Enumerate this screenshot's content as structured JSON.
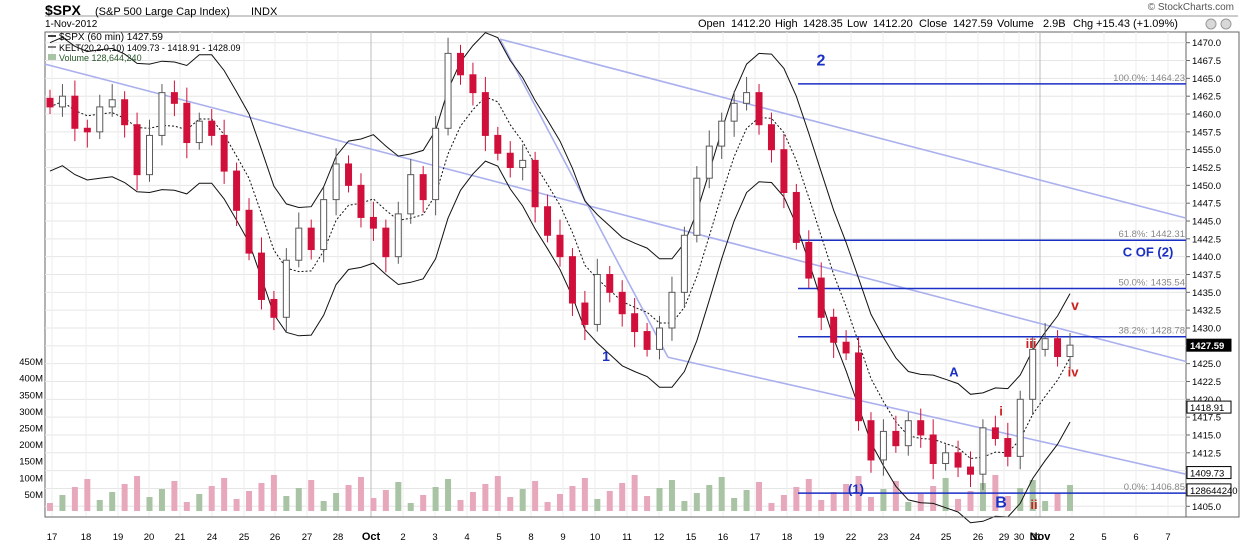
{
  "header": {
    "symbol": "$SPX",
    "name": "(S&P 500 Large Cap Index)",
    "exchange": "INDX",
    "date": "1-Nov-2012",
    "open_label": "Open",
    "open": "1412.20",
    "high_label": "High",
    "high": "1428.35",
    "low_label": "Low",
    "low": "1412.20",
    "close_label": "Close",
    "close": "1427.59",
    "volume_label": "Volume",
    "volume": "2.9B",
    "chg_label": "Chg",
    "chg": "+15.43 (+1.09%)",
    "watermark": "© StockCharts.com"
  },
  "legend": {
    "line1": "$SPX (60 min) 1427.59",
    "line2": "KELT(20,2.0,10) 1409.73 - 1418.91 - 1428.09",
    "line3": "Volume 128,644,240"
  },
  "annotations": [
    {
      "text": "2",
      "color": "#1a2fc4"
    },
    {
      "text": "1",
      "color": "#1a2fc4"
    },
    {
      "text": "(1)",
      "color": "#1a2fc4"
    },
    {
      "text": "A",
      "color": "#1a2fc4"
    },
    {
      "text": "B",
      "color": "#1a2fc4"
    },
    {
      "text": "C OF (2)",
      "color": "#1a2fc4"
    },
    {
      "text": "i",
      "color": "#cc1f1f"
    },
    {
      "text": "ii",
      "color": "#cc1f1f"
    },
    {
      "text": "iii",
      "color": "#cc1f1f"
    },
    {
      "text": "iv",
      "color": "#cc1f1f"
    },
    {
      "text": "v",
      "color": "#cc1f1f"
    }
  ],
  "fib_labels": [
    "100.0%: 1464.23",
    "61.8%: 1442.31",
    "50.0%: 1435.54",
    "38.2%: 1428.78",
    "0.0%: 1406.85"
  ],
  "price_tags": [
    "1427.59",
    "1418.91",
    "1409.73",
    "128644240"
  ],
  "colors": {
    "up": "#5a5a5a",
    "down": "#d0103a",
    "fib": "#1a2fc4",
    "channel": "#aab0ee",
    "vol_up": "#a9c4a4",
    "vol_down": "#e8a8bc"
  },
  "chart_data": {
    "type": "candlestick",
    "title": "$SPX (S&P 500 Large Cap Index) 60 min",
    "y_ticks": [
      "1470.0",
      "1467.5",
      "1465.0",
      "1462.5",
      "1460.0",
      "1457.5",
      "1455.0",
      "1452.5",
      "1450.0",
      "1447.5",
      "1445.0",
      "1442.5",
      "1440.0",
      "1437.5",
      "1435.0",
      "1432.5",
      "1430.0",
      "1427.5",
      "1425.0",
      "1422.5",
      "1420.0",
      "1417.5",
      "1415.0",
      "1412.5",
      "1410.0",
      "1407.5",
      "1405.0"
    ],
    "ylim": [
      1403.5,
      1471.5
    ],
    "vol_ticks": [
      "450M",
      "400M",
      "350M",
      "300M",
      "250M",
      "200M",
      "150M",
      "100M",
      "50M"
    ],
    "x_ticks": [
      "17",
      "18",
      "19",
      "20",
      "21",
      "24",
      "25",
      "26",
      "27",
      "28",
      "Oct",
      "2",
      "3",
      "4",
      "5",
      "8",
      "9",
      "10",
      "11",
      "12",
      "15",
      "16",
      "17",
      "18",
      "19",
      "22",
      "23",
      "24",
      "25",
      "26",
      "29",
      "30",
      "31",
      "Nov",
      "2",
      "5",
      "6",
      "7"
    ],
    "close_series": [
      1461.0,
      1462.5,
      1458.0,
      1457.5,
      1461.0,
      1462.0,
      1458.5,
      1451.5,
      1457.0,
      1463.0,
      1461.5,
      1456.0,
      1459.0,
      1457.0,
      1452.0,
      1446.5,
      1440.5,
      1434.0,
      1431.5,
      1439.5,
      1444.0,
      1441.0,
      1448.0,
      1453.0,
      1450.0,
      1445.5,
      1444.0,
      1440.0,
      1446.0,
      1451.5,
      1448.0,
      1458.0,
      1468.5,
      1465.5,
      1463.0,
      1457.0,
      1454.5,
      1452.5,
      1453.5,
      1447.0,
      1443.0,
      1440.0,
      1433.5,
      1430.5,
      1437.5,
      1435.0,
      1432.0,
      1429.5,
      1427.0,
      1430.0,
      1435.0,
      1443.0,
      1451.0,
      1455.5,
      1459.0,
      1461.5,
      1463.0,
      1458.5,
      1455.0,
      1449.0,
      1442.0,
      1437.0,
      1431.5,
      1428.0,
      1426.5,
      1417.0,
      1411.5,
      1415.5,
      1413.5,
      1417.0,
      1415.0,
      1411.0,
      1412.5,
      1410.5,
      1409.5,
      1416.0,
      1414.5,
      1412.0,
      1420.0,
      1427.0,
      1428.5,
      1426.0,
      1427.59
    ],
    "kelt_upper_end": 1428.09,
    "kelt_mid_end": 1418.91,
    "kelt_lower_end": 1409.73,
    "fib_levels": [
      1464.23,
      1442.31,
      1435.54,
      1428.78,
      1406.85
    ]
  }
}
